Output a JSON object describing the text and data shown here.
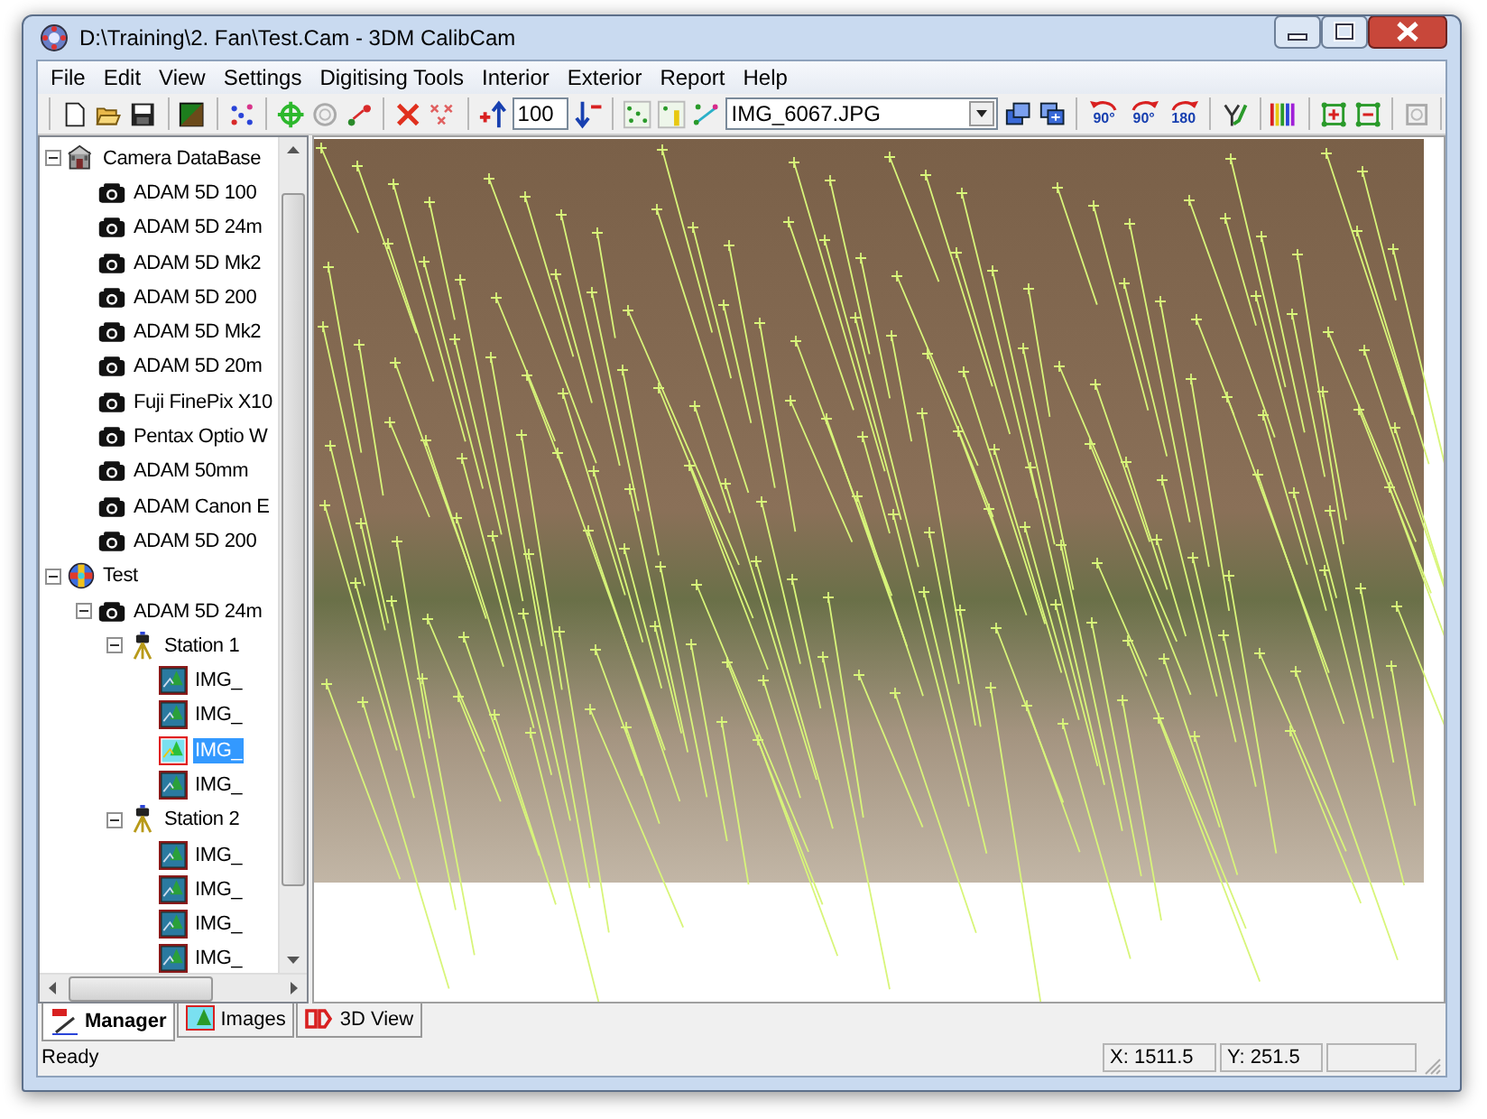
{
  "window": {
    "title": "D:\\Training\\2. Fan\\Test.Cam - 3DM CalibCam"
  },
  "menu": [
    {
      "label": "File"
    },
    {
      "label": "Edit"
    },
    {
      "label": "View"
    },
    {
      "label": "Settings"
    },
    {
      "label": "Digitising Tools"
    },
    {
      "label": "Interior"
    },
    {
      "label": "Exterior"
    },
    {
      "label": "Report"
    },
    {
      "label": "Help"
    }
  ],
  "toolbar": {
    "zoom_value": "100",
    "image_dropdown": "IMG_6067.JPG",
    "rotate_buttons": [
      {
        "label": "90°"
      },
      {
        "label": "90°"
      },
      {
        "label": "180"
      }
    ]
  },
  "tree": [
    {
      "kind": "database",
      "label": "Camera DataBase",
      "expanded": true,
      "selected": false,
      "children": [
        {
          "kind": "camera",
          "label": "ADAM 5D 100",
          "selected": false
        },
        {
          "kind": "camera",
          "label": "ADAM 5D 24m",
          "selected": false
        },
        {
          "kind": "camera",
          "label": "ADAM 5D Mk2",
          "selected": false
        },
        {
          "kind": "camera",
          "label": "ADAM 5D 200",
          "selected": false
        },
        {
          "kind": "camera",
          "label": "ADAM 5D Mk2",
          "selected": false
        },
        {
          "kind": "camera",
          "label": "ADAM 5D 20m",
          "selected": false
        },
        {
          "kind": "camera",
          "label": "Fuji FinePix X10",
          "selected": false
        },
        {
          "kind": "camera",
          "label": "Pentax Optio W",
          "selected": false
        },
        {
          "kind": "camera",
          "label": "ADAM 50mm",
          "selected": false
        },
        {
          "kind": "camera",
          "label": "ADAM Canon E",
          "selected": false
        },
        {
          "kind": "camera",
          "label": "ADAM 5D 200",
          "selected": false
        }
      ]
    },
    {
      "kind": "project",
      "label": "Test",
      "expanded": true,
      "selected": false,
      "children": [
        {
          "kind": "camera",
          "label": "ADAM 5D 24m",
          "expanded": true,
          "selected": false,
          "children": [
            {
              "kind": "station",
              "label": "Station 1",
              "expanded": true,
              "selected": false,
              "children": [
                {
                  "kind": "image",
                  "label": "IMG_",
                  "selected": false
                },
                {
                  "kind": "image",
                  "label": "IMG_",
                  "selected": false
                },
                {
                  "kind": "image",
                  "label": "IMG_",
                  "selected": true
                },
                {
                  "kind": "image",
                  "label": "IMG_",
                  "selected": false
                }
              ]
            },
            {
              "kind": "station",
              "label": "Station 2",
              "expanded": true,
              "selected": false,
              "children": [
                {
                  "kind": "image",
                  "label": "IMG_",
                  "selected": false
                },
                {
                  "kind": "image",
                  "label": "IMG_",
                  "selected": false
                },
                {
                  "kind": "image",
                  "label": "IMG_",
                  "selected": false
                },
                {
                  "kind": "image",
                  "label": "IMG_",
                  "selected": false
                }
              ]
            }
          ]
        }
      ]
    }
  ],
  "tabs": [
    {
      "kind": "manager",
      "label": "Manager",
      "selected": true
    },
    {
      "kind": "images",
      "label": "Images",
      "selected": false
    },
    {
      "kind": "model",
      "label": "3D View",
      "selected": false
    }
  ],
  "status_bar": {
    "message": "Ready",
    "x": "X: 1511.5",
    "y": "Y: 251.5"
  }
}
